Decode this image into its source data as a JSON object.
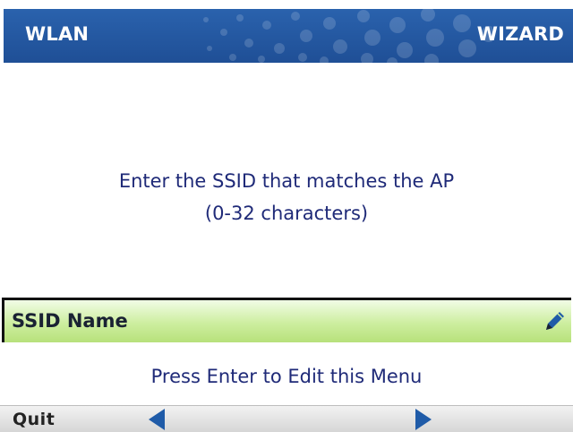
{
  "header": {
    "left_title": "WLAN",
    "right_title": "WIZARD"
  },
  "instructions": {
    "line1": "Enter the SSID that matches the AP",
    "line2": "(0-32 characters)"
  },
  "field": {
    "label": "SSID Name",
    "edit_icon": "pencil-icon"
  },
  "hint": "Press Enter to Edit this Menu",
  "softkeys": {
    "left_label": "Quit",
    "prev_icon": "left-arrow-icon",
    "next_icon": "right-arrow-icon"
  },
  "colors": {
    "header_bg": "#2a62ad",
    "text_blue": "#1f2a78",
    "field_green": "#cdee9f",
    "arrow_blue": "#1f5ba8"
  }
}
